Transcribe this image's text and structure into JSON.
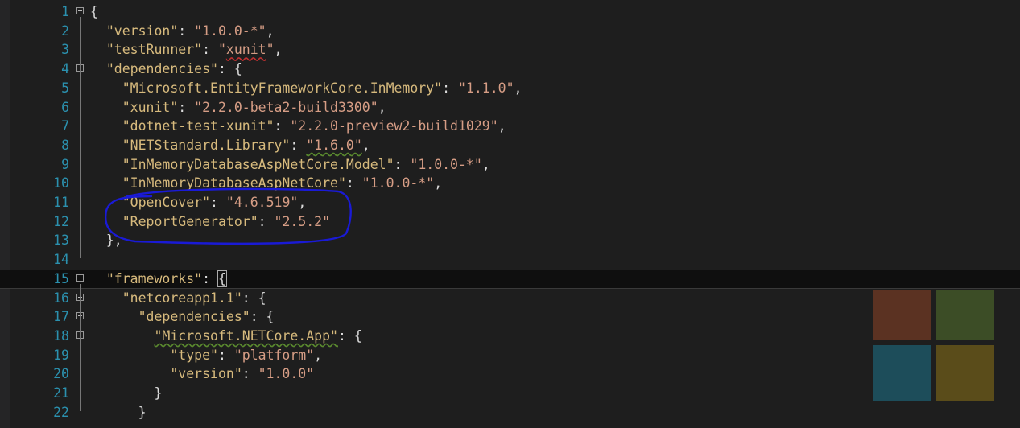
{
  "editor": {
    "lines": [
      {
        "n": "1",
        "fold": true,
        "parts": [
          [
            "p",
            "{"
          ]
        ]
      },
      {
        "n": "2",
        "fold": false,
        "parts": [
          [
            "p",
            "  "
          ],
          [
            "key",
            "\"version\""
          ],
          [
            "p",
            ": "
          ],
          [
            "str",
            "\"1.0.0-*\""
          ],
          [
            "p",
            ","
          ]
        ]
      },
      {
        "n": "3",
        "fold": false,
        "parts": [
          [
            "p",
            "  "
          ],
          [
            "key",
            "\"testRunner\""
          ],
          [
            "p",
            ": "
          ],
          [
            "str",
            "\""
          ],
          [
            "str-red",
            "xunit"
          ],
          [
            "str",
            "\""
          ],
          [
            "p",
            ","
          ]
        ]
      },
      {
        "n": "4",
        "fold": true,
        "parts": [
          [
            "p",
            "  "
          ],
          [
            "key",
            "\"dependencies\""
          ],
          [
            "p",
            ": {"
          ]
        ]
      },
      {
        "n": "5",
        "fold": false,
        "parts": [
          [
            "p",
            "    "
          ],
          [
            "key",
            "\"Microsoft.EntityFrameworkCore.InMemory\""
          ],
          [
            "p",
            ": "
          ],
          [
            "str",
            "\"1.1.0\""
          ],
          [
            "p",
            ","
          ]
        ]
      },
      {
        "n": "6",
        "fold": false,
        "parts": [
          [
            "p",
            "    "
          ],
          [
            "key",
            "\"xunit\""
          ],
          [
            "p",
            ": "
          ],
          [
            "str",
            "\"2.2.0-beta2-build3300\""
          ],
          [
            "p",
            ","
          ]
        ]
      },
      {
        "n": "7",
        "fold": false,
        "parts": [
          [
            "p",
            "    "
          ],
          [
            "key",
            "\"dotnet-test-xunit\""
          ],
          [
            "p",
            ": "
          ],
          [
            "str",
            "\"2.2.0-preview2-build1029\""
          ],
          [
            "p",
            ","
          ]
        ]
      },
      {
        "n": "8",
        "fold": false,
        "parts": [
          [
            "p",
            "    "
          ],
          [
            "key",
            "\"NETStandard.Library\""
          ],
          [
            "p",
            ": "
          ],
          [
            "str-green",
            "\"1.6.0\""
          ],
          [
            "p",
            ","
          ]
        ]
      },
      {
        "n": "9",
        "fold": false,
        "parts": [
          [
            "p",
            "    "
          ],
          [
            "key",
            "\"InMemoryDatabaseAspNetCore.Model\""
          ],
          [
            "p",
            ": "
          ],
          [
            "str",
            "\"1.0.0-*\""
          ],
          [
            "p",
            ","
          ]
        ]
      },
      {
        "n": "10",
        "fold": false,
        "parts": [
          [
            "p",
            "    "
          ],
          [
            "key",
            "\"InMemoryDatabaseAspNetCore\""
          ],
          [
            "p",
            ": "
          ],
          [
            "str",
            "\"1.0.0-*\""
          ],
          [
            "p",
            ","
          ]
        ]
      },
      {
        "n": "11",
        "fold": false,
        "parts": [
          [
            "p",
            "    "
          ],
          [
            "key",
            "\"OpenCover\""
          ],
          [
            "p",
            ": "
          ],
          [
            "str",
            "\"4.6.519\""
          ],
          [
            "p",
            ","
          ]
        ]
      },
      {
        "n": "12",
        "fold": false,
        "parts": [
          [
            "p",
            "    "
          ],
          [
            "key",
            "\"ReportGenerator\""
          ],
          [
            "p",
            ": "
          ],
          [
            "str",
            "\"2.5.2\""
          ]
        ]
      },
      {
        "n": "13",
        "fold": false,
        "parts": [
          [
            "p",
            "  },"
          ]
        ]
      },
      {
        "n": "14",
        "fold": false,
        "parts": [
          [
            "p",
            ""
          ]
        ]
      },
      {
        "n": "15",
        "fold": true,
        "current": true,
        "parts": [
          [
            "p",
            "  "
          ],
          [
            "key",
            "\"frameworks\""
          ],
          [
            "p",
            ": "
          ],
          [
            "brace",
            "{"
          ]
        ]
      },
      {
        "n": "16",
        "fold": true,
        "parts": [
          [
            "p",
            "    "
          ],
          [
            "key",
            "\"netcoreapp1.1\""
          ],
          [
            "p",
            ": {"
          ]
        ]
      },
      {
        "n": "17",
        "fold": true,
        "parts": [
          [
            "p",
            "      "
          ],
          [
            "key",
            "\"dependencies\""
          ],
          [
            "p",
            ": {"
          ]
        ]
      },
      {
        "n": "18",
        "fold": true,
        "parts": [
          [
            "p",
            "        "
          ],
          [
            "key-green",
            "\"Microsoft.NETCore.App\""
          ],
          [
            "p",
            ": {"
          ]
        ]
      },
      {
        "n": "19",
        "fold": false,
        "parts": [
          [
            "p",
            "          "
          ],
          [
            "key",
            "\"type\""
          ],
          [
            "p",
            ": "
          ],
          [
            "str",
            "\"platform\""
          ],
          [
            "p",
            ","
          ]
        ]
      },
      {
        "n": "20",
        "fold": false,
        "parts": [
          [
            "p",
            "          "
          ],
          [
            "key",
            "\"version\""
          ],
          [
            "p",
            ": "
          ],
          [
            "str",
            "\"1.0.0\""
          ]
        ]
      },
      {
        "n": "21",
        "fold": false,
        "parts": [
          [
            "p",
            "        }"
          ]
        ]
      },
      {
        "n": "22",
        "fold": false,
        "parts": [
          [
            "p",
            "      }"
          ]
        ]
      }
    ]
  },
  "logo_tiles": {
    "colors": [
      "#5b3222",
      "#3c4d26",
      "#1d4d5a",
      "#5a4c1a"
    ]
  },
  "annotation": {
    "color": "#1a1ad6"
  }
}
